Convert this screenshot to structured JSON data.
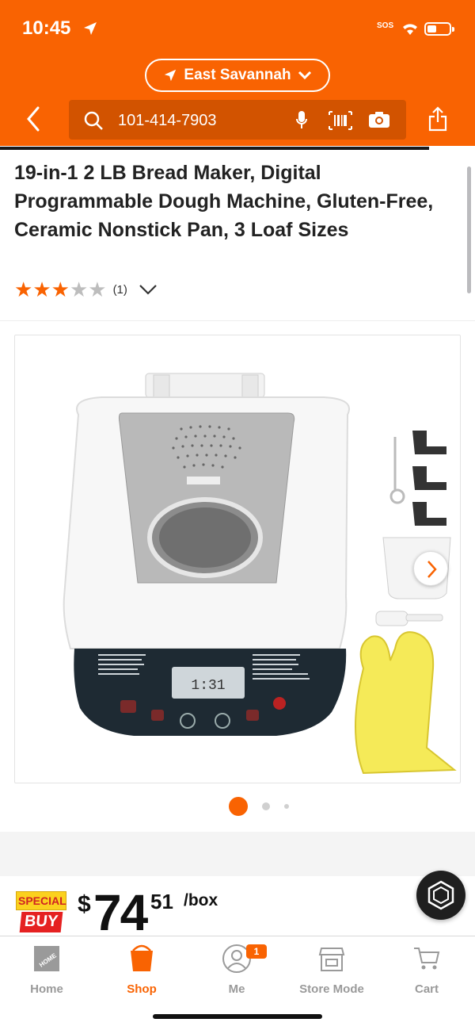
{
  "status_bar": {
    "time": "10:45",
    "sos": "SOS"
  },
  "header": {
    "store": "East Savannah",
    "search_query": "101-414-7903"
  },
  "product": {
    "title": "19-in-1 2 LB Bread Maker, Digital Programmable Dough Machine, Gluten-Free, Ceramic Nonstick Pan, 3 Loaf Sizes",
    "rating_value": 3,
    "rating_max": 5,
    "review_count": "(1)"
  },
  "carousel": {
    "current": 1,
    "total": 3
  },
  "pricing": {
    "badge_top": "SPECIAL",
    "badge_bottom": "BUY",
    "currency": "$",
    "dollars": "74",
    "cents": "51",
    "unit": "/box"
  },
  "tabbar": {
    "items": [
      {
        "label": "Home"
      },
      {
        "label": "Shop"
      },
      {
        "label": "Me",
        "badge": "1"
      },
      {
        "label": "Store Mode"
      },
      {
        "label": "Cart"
      }
    ],
    "active": "Shop"
  },
  "colors": {
    "brand": "#f96302",
    "search_bg": "#d25300"
  }
}
